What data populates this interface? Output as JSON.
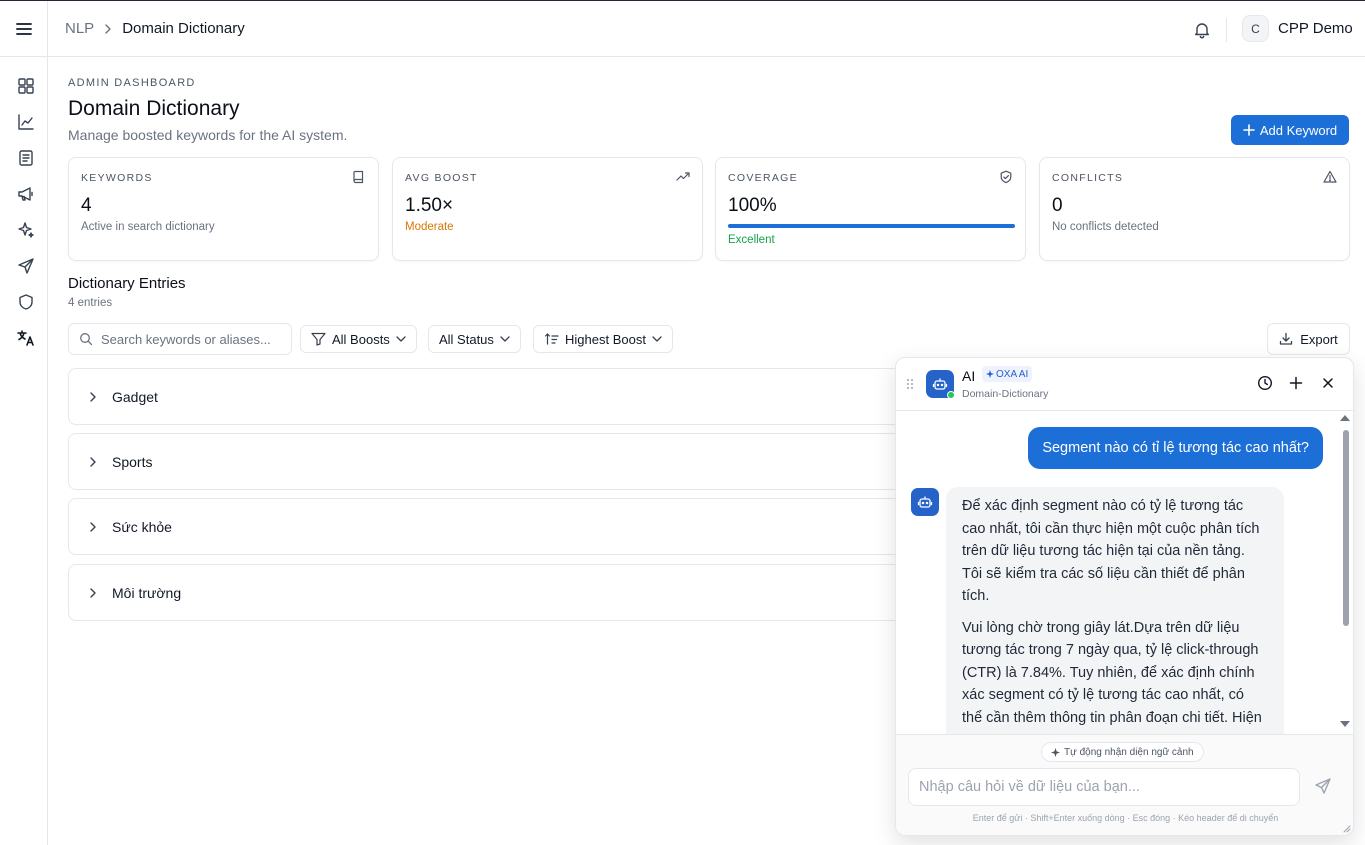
{
  "topbar": {
    "breadcrumb_parent": "NLP",
    "breadcrumb_current": "Domain Dictionary",
    "user_initial": "C",
    "user_name": "CPP Demo"
  },
  "sidebar": {
    "items": [
      {
        "name": "dashboard",
        "icon": "grid-icon"
      },
      {
        "name": "analytics",
        "icon": "chart-icon"
      },
      {
        "name": "documents",
        "icon": "document-icon"
      },
      {
        "name": "campaigns",
        "icon": "megaphone-icon"
      },
      {
        "name": "ai",
        "icon": "sparkles-icon"
      },
      {
        "name": "send",
        "icon": "send-icon"
      },
      {
        "name": "security",
        "icon": "shield-icon"
      },
      {
        "name": "nlp",
        "icon": "translate-icon",
        "active": true
      }
    ]
  },
  "header": {
    "eyebrow": "ADMIN DASHBOARD",
    "title": "Domain Dictionary",
    "subtitle": "Manage boosted keywords for the AI system.",
    "add_button": "Add Keyword"
  },
  "stats": [
    {
      "label": "KEYWORDS",
      "value": "4",
      "caption": "Active in search dictionary",
      "caption_color": "#6b7280",
      "icon": "book-icon"
    },
    {
      "label": "AVG BOOST",
      "value": "1.50×",
      "caption": "Moderate",
      "caption_color": "#d97706",
      "icon": "trending-up-icon"
    },
    {
      "label": "COVERAGE",
      "value": "100%",
      "caption": "Excellent",
      "caption_color": "#16a34a",
      "icon": "shield-check-icon",
      "progress": 1.0
    },
    {
      "label": "CONFLICTS",
      "value": "0",
      "caption": "No conflicts detected",
      "caption_color": "#6b7280",
      "icon": "warning-icon"
    }
  ],
  "entries_section": {
    "title": "Dictionary Entries",
    "count": "4 entries",
    "search_placeholder": "Search keywords or aliases...",
    "filters": [
      "All Boosts",
      "All Status",
      "Highest Boost"
    ],
    "export_label": "Export",
    "entries": [
      "Gadget",
      "Sports",
      "Sức khỏe",
      "Môi trường"
    ]
  },
  "chat": {
    "title": "AI",
    "badge": "OXA AI",
    "context": "Domain-Dictionary",
    "user_message": "Segment nào có tỉ lệ tương tác cao nhất?",
    "bot_paragraph_1": "Để xác định segment nào có tỷ lệ tương tác cao nhất, tôi cần thực hiện một cuộc phân tích trên dữ liệu tương tác hiện tại của nền tảng. Tôi sẽ kiểm tra các số liệu cần thiết để phân tích.",
    "bot_paragraph_2": "Vui lòng chờ trong giây lát.Dựa trên dữ liệu tương tác trong 7 ngày qua, tỷ lệ click-through (CTR) là 7.84%. Tuy nhiên, để xác định chính xác segment có tỷ lệ tương tác cao nhất, có thể cần thêm thông tin phân đoạn chi tiết. Hiện",
    "context_chip": "Tự động nhận diện ngữ cảnh",
    "input_placeholder": "Nhập câu hỏi về dữ liệu của bạn...",
    "hint": "Enter để gửi · Shift+Enter xuống dòng · Esc đóng · Kéo header để di chuyển"
  },
  "colors": {
    "accent": "#1d6fd8",
    "bot_avatar": "#2563c9",
    "online": "#22c55e",
    "border": "#e5e7eb"
  }
}
